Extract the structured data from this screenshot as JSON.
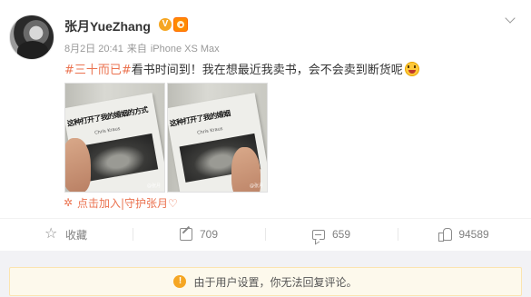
{
  "post": {
    "username": "张月YueZhang",
    "verified_mark": "V",
    "date": "8月2日 20:41",
    "source_prefix": "来自",
    "source_device": "iPhone XS Max",
    "hashtag": "#三十而已#",
    "text": "看书时间到！我在想最近我卖书，会不会卖到断货呢",
    "emoji": "laughing-emoji",
    "images": [
      {
        "book_title": "这种打开了我的婚姻的方式",
        "author": "Chris Kraus",
        "watermark": "@张月"
      },
      {
        "book_title": "这种打开了我的婚姻",
        "author": "Chris Kraus",
        "watermark": "@张月"
      }
    ],
    "guard_text": "点击加入|守护张月♡"
  },
  "actions": {
    "favorite_label": "收藏",
    "repost_count": "709",
    "comment_count": "659",
    "like_count": "94589"
  },
  "notice": {
    "icon": "warning-icon",
    "text": "由于用户设置，你无法回复评论。"
  },
  "colors": {
    "accent": "#eb7350",
    "verified": "#f5a623",
    "muted": "#808080"
  }
}
